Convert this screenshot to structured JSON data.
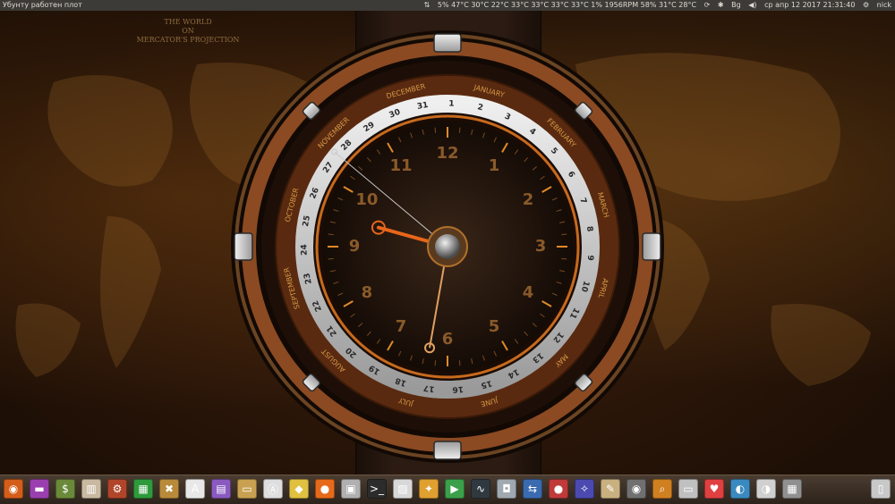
{
  "top_panel": {
    "window_title": "Убунту работен плот",
    "sensors": "5% 47°C 30°C 22°C 33°C 33°C 33°C 33°C 1% 1956RPM 58% 31°C 28°C",
    "keyboard_layout": "Bg",
    "datetime": "ср апр 12 2017 21:31:40",
    "user": "nick"
  },
  "wallpaper": {
    "map_title_line1": "THE WORLD",
    "map_title_line2": "ON",
    "map_title_line3": "MERCATOR'S PROJECTION"
  },
  "clock": {
    "hour_numerals": [
      "12",
      "1",
      "2",
      "3",
      "4",
      "5",
      "6",
      "7",
      "8",
      "9",
      "10",
      "11"
    ],
    "day_numbers": [
      "1",
      "2",
      "3",
      "4",
      "5",
      "6",
      "7",
      "8",
      "9",
      "10",
      "11",
      "12",
      "13",
      "14",
      "15",
      "16",
      "17",
      "18",
      "19",
      "20",
      "21",
      "22",
      "23",
      "24",
      "25",
      "26",
      "27",
      "28",
      "29",
      "30",
      "31"
    ],
    "months": [
      "JANUARY",
      "FEBRUARY",
      "MARCH",
      "APRIL",
      "MAY",
      "JUNE",
      "JULY",
      "AUGUST",
      "SEPTEMBER",
      "OCTOBER",
      "NOVEMBER",
      "DECEMBER"
    ],
    "time": {
      "hours": 21,
      "minutes": 31,
      "seconds": 40
    },
    "date": {
      "day": 12,
      "month": 4
    },
    "colors": {
      "hour_hand": "#e8661a",
      "minute_hand": "#e0a060",
      "second_hand": "#c8c8c8",
      "numeral": "#8a5a2a",
      "month_text": "#d69a46",
      "day_ring": "#d8d8d8",
      "day_text": "#2a2a2a"
    }
  },
  "launcher": {
    "icons": [
      {
        "name": "dash-home-icon",
        "color": "#d55d1a",
        "glyph": "◉"
      },
      {
        "name": "purple-app-icon",
        "color": "#9b3fb0",
        "glyph": "▬"
      },
      {
        "name": "money-app-icon",
        "color": "#6a8a3a",
        "glyph": "$"
      },
      {
        "name": "columns-app-icon",
        "color": "#c9b9a0",
        "glyph": "▥"
      },
      {
        "name": "settings-gears-icon",
        "color": "#b0452a",
        "glyph": "⚙"
      },
      {
        "name": "spreadsheet-app-icon",
        "color": "#2e9a3c",
        "glyph": "▦"
      },
      {
        "name": "tools-app-icon",
        "color": "#b88a3a",
        "glyph": "✖"
      },
      {
        "name": "font-viewer-icon",
        "color": "#e8e8e8",
        "glyph": "A"
      },
      {
        "name": "media-app-icon",
        "color": "#8a5ac0",
        "glyph": "▤"
      },
      {
        "name": "files-folder-icon",
        "color": "#c8a050",
        "glyph": "▭"
      },
      {
        "name": "software-center-icon",
        "color": "#dedede",
        "glyph": "Ⓐ"
      },
      {
        "name": "cheese-app-icon",
        "color": "#e0c040",
        "glyph": "◆"
      },
      {
        "name": "firefox-icon",
        "color": "#e66a1a",
        "glyph": "●"
      },
      {
        "name": "archive-app-icon",
        "color": "#b0b0b0",
        "glyph": "▣"
      },
      {
        "name": "terminal-icon",
        "color": "#2c2c2c",
        "glyph": ">_"
      },
      {
        "name": "photo-app-icon",
        "color": "#d8d8d8",
        "glyph": "▨"
      },
      {
        "name": "bitcoin-app-icon",
        "color": "#e0a030",
        "glyph": "✦"
      },
      {
        "name": "green-flag-app-icon",
        "color": "#3aa04a",
        "glyph": "▶"
      },
      {
        "name": "system-monitor-icon",
        "color": "#303840",
        "glyph": "∿"
      },
      {
        "name": "camera-app-icon",
        "color": "#a0a8b0",
        "glyph": "◘"
      },
      {
        "name": "transfer-app-icon",
        "color": "#3a6ab0",
        "glyph": "⇆"
      },
      {
        "name": "recorder-app-icon",
        "color": "#c03a3a",
        "glyph": "●"
      },
      {
        "name": "wizard-app-icon",
        "color": "#4a4ab0",
        "glyph": "✧"
      },
      {
        "name": "pencil-app-icon",
        "color": "#c8b080",
        "glyph": "✎"
      },
      {
        "name": "eye-app-icon",
        "color": "#707070",
        "glyph": "◉"
      },
      {
        "name": "magnifier-app-icon",
        "color": "#d08020",
        "glyph": "⌕"
      },
      {
        "name": "drive-app-icon",
        "color": "#c0c0c0",
        "glyph": "▭"
      },
      {
        "name": "balloon-app-icon",
        "color": "#e04040",
        "glyph": "♥"
      },
      {
        "name": "globe-app-icon",
        "color": "#3a8ac0",
        "glyph": "◐"
      },
      {
        "name": "disk-app-icon",
        "color": "#d0d0d0",
        "glyph": "◑"
      },
      {
        "name": "grid-app-icon",
        "color": "#909090",
        "glyph": "▦"
      },
      {
        "name": "trash-icon",
        "color": "#c8c8c8",
        "glyph": "▯"
      }
    ]
  }
}
